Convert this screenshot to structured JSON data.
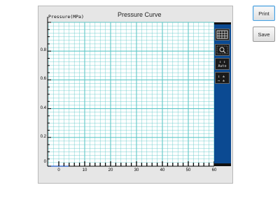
{
  "chart_data": {
    "type": "line",
    "title": "Pressure Curve",
    "ylabel": "Pressure(MPa)",
    "xlabel": "",
    "xlim": [
      0,
      60
    ],
    "ylim": [
      0,
      1.0
    ],
    "x_ticks": [
      "0",
      "10",
      "20",
      "30",
      "40",
      "50",
      "60"
    ],
    "y_ticks": [
      "0",
      "0.2",
      "0.4",
      "0.6",
      "0.8"
    ],
    "grid": true,
    "series": []
  },
  "toolbar": {
    "grid_icon": "grid-icon",
    "zoom_icon": "zoom-icon",
    "auto_label": "Auto",
    "scale_icon": "scale-icon"
  },
  "buttons": {
    "print_label": "Print",
    "save_label": "Save"
  },
  "colors": {
    "grid": "#5fc7c7",
    "background": "#ffffff",
    "toolstrip": "#0b4a92"
  }
}
